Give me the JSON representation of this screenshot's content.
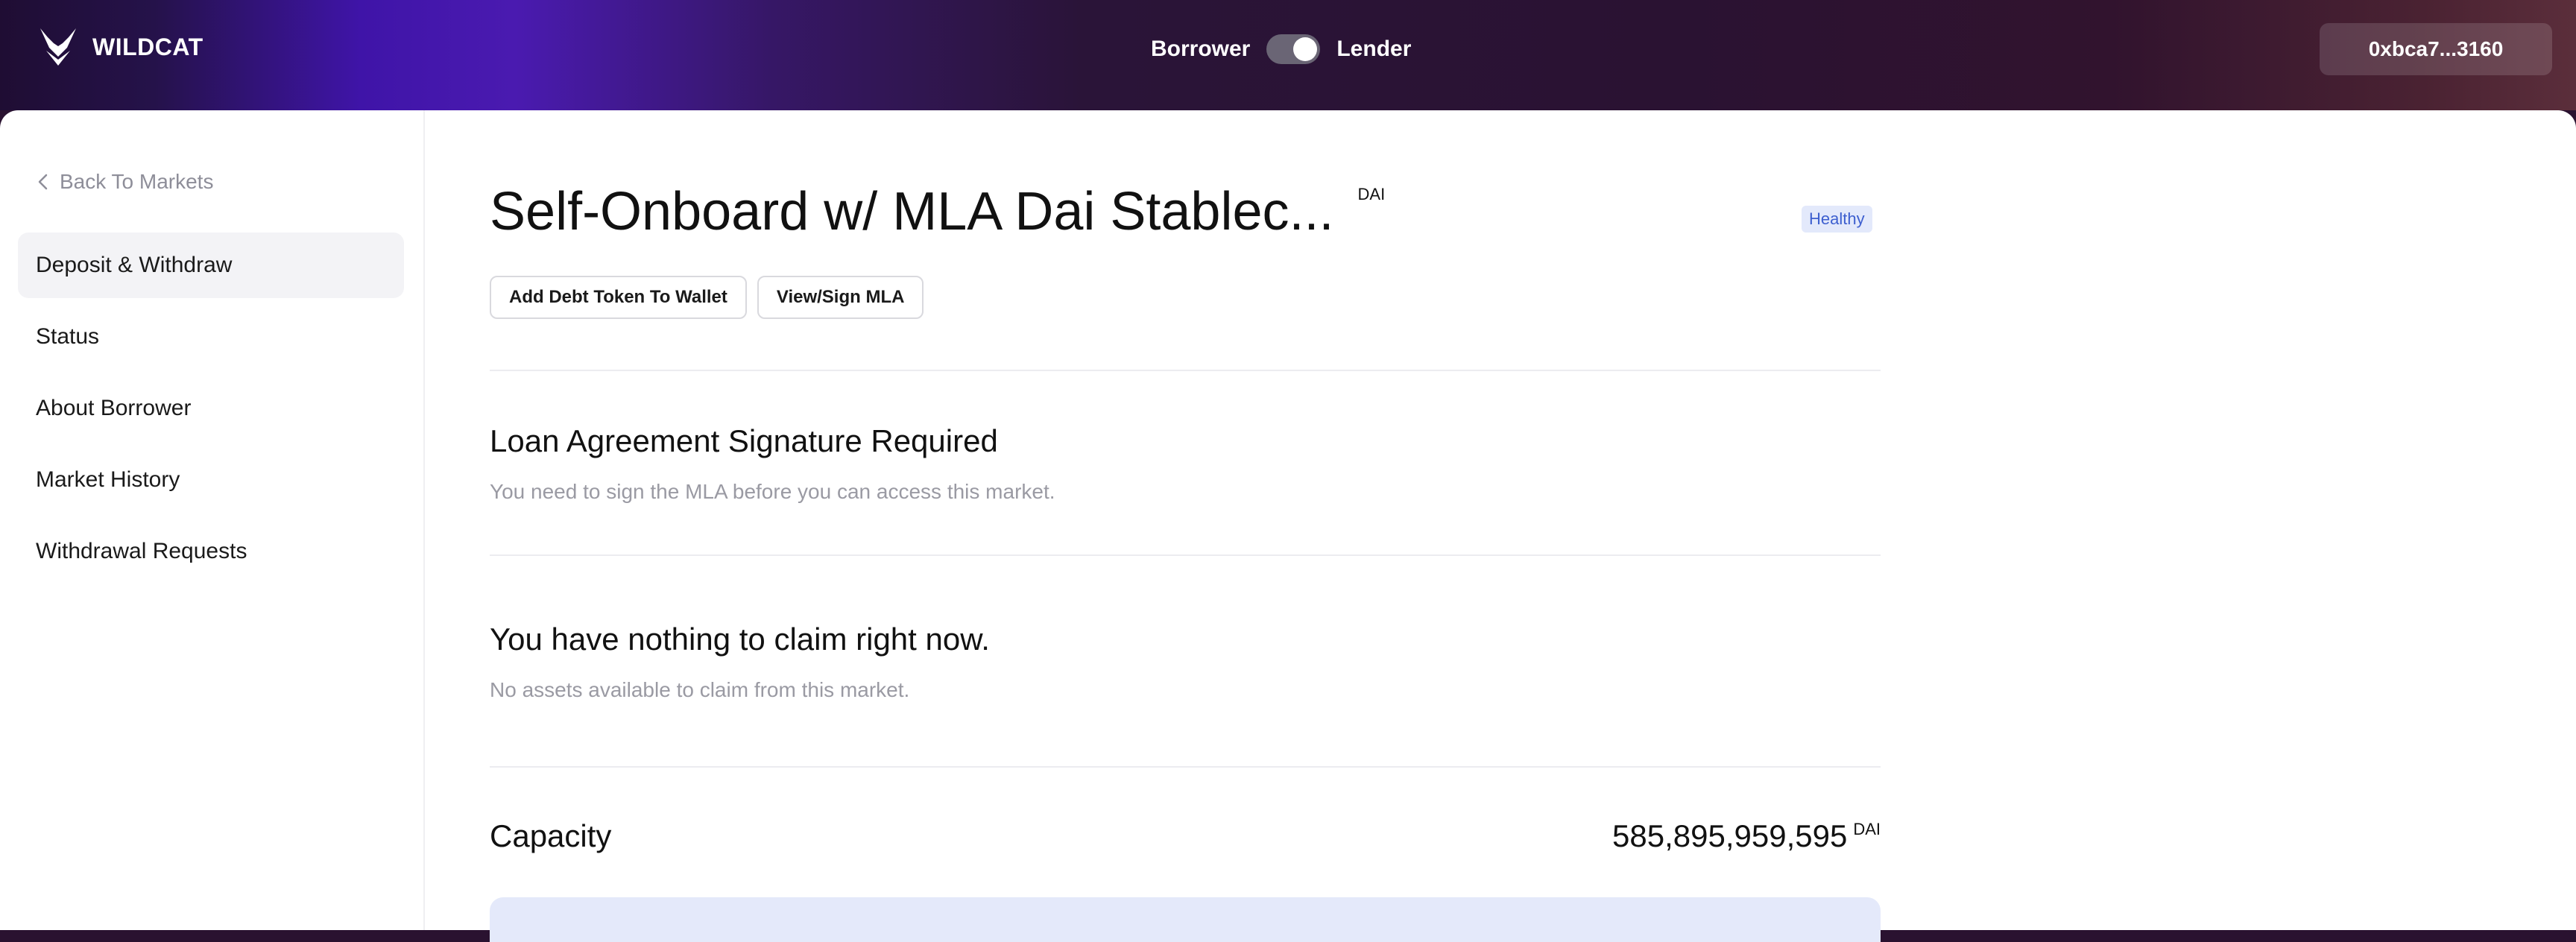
{
  "header": {
    "brand": "WILDCAT",
    "toggle": {
      "left_label": "Borrower",
      "right_label": "Lender",
      "selected": "Lender"
    },
    "wallet": "0xbca7...3160"
  },
  "sidebar": {
    "back_label": "Back To Markets",
    "items": [
      {
        "label": "Deposit & Withdraw",
        "active": true
      },
      {
        "label": "Status"
      },
      {
        "label": "About Borrower"
      },
      {
        "label": "Market History"
      },
      {
        "label": "Withdrawal Requests"
      }
    ]
  },
  "market": {
    "title": "Self-Onboard w/ MLA Dai Stablec...",
    "token": "DAI",
    "status": "Healthy",
    "buttons": {
      "add_token": "Add Debt Token To Wallet",
      "view_mla": "View/Sign MLA"
    }
  },
  "sections": {
    "mla": {
      "title": "Loan Agreement Signature Required",
      "subtitle": "You need to sign the MLA before you can access this market."
    },
    "claim": {
      "title": "You have nothing to claim right now.",
      "subtitle": "No assets available to claim from this market."
    },
    "capacity": {
      "label": "Capacity",
      "value": "585,895,959,595",
      "unit": "DAI"
    }
  },
  "colors": {
    "accent": "#4a1ab0",
    "badge_bg": "#e3e9fb",
    "badge_text": "#3d5fcf",
    "info_box": "#e4e9fa"
  }
}
